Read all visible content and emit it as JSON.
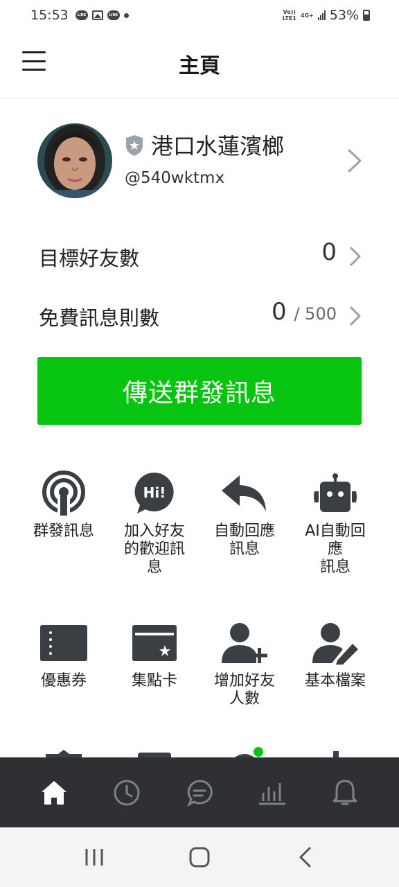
{
  "status_bar": {
    "time": "15:53",
    "notif_label": "LINE",
    "volte_label": "Vo))\nLTE1",
    "network_label": "4G+",
    "battery_percent": "53%"
  },
  "header": {
    "title": "主頁"
  },
  "profile": {
    "account_name": "港口水蓮濱榔",
    "account_id": "@540wktmx"
  },
  "stats": {
    "target_friends_label": "目標好友數",
    "target_friends_value": "0",
    "free_messages_label": "免費訊息則數",
    "free_messages_value": "0",
    "free_messages_limit": "/ 500"
  },
  "broadcast_button": "傳送群發訊息",
  "features": [
    {
      "label": "群發訊息",
      "icon": "broadcast-icon"
    },
    {
      "label": "加入好友\n的歡迎訊\n息",
      "icon": "hi-bubble-icon"
    },
    {
      "label": "自動回應\n訊息",
      "icon": "reply-arrow-icon"
    },
    {
      "label": "AI自動回\n應\n訊息",
      "icon": "robot-icon"
    },
    {
      "label": "優惠券",
      "icon": "coupon-icon"
    },
    {
      "label": "集點卡",
      "icon": "reward-card-icon"
    },
    {
      "label": "增加好友\n人數",
      "icon": "add-friend-icon"
    },
    {
      "label": "基本檔案",
      "icon": "profile-edit-icon"
    }
  ],
  "bottom_nav": [
    "home-icon",
    "clock-icon",
    "chat-icon",
    "insights-icon",
    "bell-icon"
  ],
  "colors": {
    "accent_green": "#06c40f",
    "nav_bg": "#2e3033",
    "icon_dark": "#3a3f44"
  }
}
